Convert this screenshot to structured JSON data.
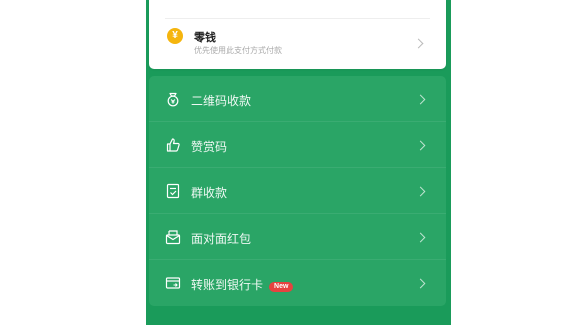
{
  "wallet_card": {
    "title": "零钱",
    "subtitle": "优先使用此支付方式付款",
    "coin_symbol": "¥",
    "icon": "coin-icon"
  },
  "menu": {
    "items": [
      {
        "label": "二维码收款",
        "icon": "money-bag-icon"
      },
      {
        "label": "赞赏码",
        "icon": "thumbs-up-icon"
      },
      {
        "label": "群收款",
        "icon": "group-receipt-icon"
      },
      {
        "label": "面对面红包",
        "icon": "red-packet-icon"
      },
      {
        "label": "转账到银行卡",
        "icon": "bank-card-icon",
        "badge": "New"
      }
    ]
  },
  "colors": {
    "background": "#1a9b5a",
    "group_background": "#2aa566",
    "badge": "#e64340",
    "coin": "#f5b50e"
  }
}
